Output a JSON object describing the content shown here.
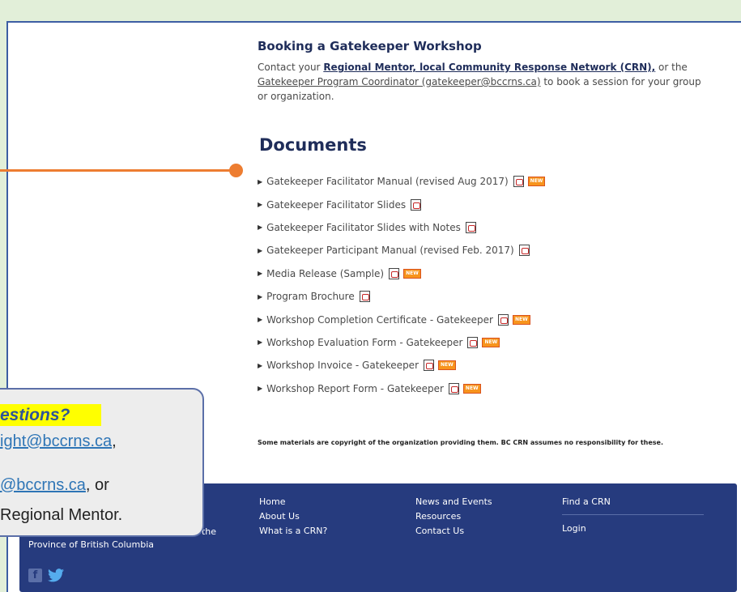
{
  "booking": {
    "title": "Booking a Gatekeeper Workshop",
    "text_before": "Contact your ",
    "link_mentor": "Regional Mentor, local Community Response Network (CRN),",
    "text_or": " or the ",
    "link_coordinator": "Gatekeeper Program Coordinator (gatekeeper@bccrns.ca)",
    "text_after": " to book a session for your group or organization."
  },
  "documents": {
    "title": "Documents",
    "items": [
      {
        "label": "Gatekeeper Facilitator Manual (revised Aug 2017)",
        "pdf": true,
        "new": true
      },
      {
        "label": "Gatekeeper Facilitator Slides",
        "pdf": true,
        "new": false
      },
      {
        "label": "Gatekeeper Facilitator Slides with Notes",
        "pdf": true,
        "new": false
      },
      {
        "label": "Gatekeeper Participant Manual (revised Feb. 2017)",
        "pdf": true,
        "new": false
      },
      {
        "label": "Media Release (Sample)",
        "pdf": true,
        "new": true
      },
      {
        "label": "Program Brochure",
        "pdf": true,
        "new": false
      },
      {
        "label": "Workshop Completion Certificate - Gatekeeper",
        "pdf": true,
        "new": true
      },
      {
        "label": "Workshop Evaluation Form - Gatekeeper",
        "pdf": true,
        "new": true
      },
      {
        "label": "Workshop Invoice - Gatekeeper",
        "pdf": true,
        "new": true
      },
      {
        "label": "Workshop Report Form - Gatekeeper",
        "pdf": true,
        "new": true
      }
    ],
    "new_label": "NEW"
  },
  "disclaimer": "Some materials are copyright of the organization providing them. BC CRN assumes no responsibility for these.",
  "footer": {
    "col1": [
      "Home",
      "About Us",
      "What is a CRN?"
    ],
    "col2": [
      "News and Events",
      "Resources",
      "Contact Us"
    ],
    "find_crn": "Find a CRN",
    "login": "Login",
    "left_tail": ", the",
    "left_line": "Province of British Columbia"
  },
  "callout": {
    "title": "estions?",
    "line1_link": "ight@bccrns.ca",
    "line1_rest": ",",
    "line2_link": "@bccrns.ca",
    "line2_rest": ", or",
    "line3": "Regional Mentor."
  },
  "colors": {
    "accent_orange": "#ed7d31",
    "navy": "#263b7e",
    "highlight": "#ffff00"
  }
}
